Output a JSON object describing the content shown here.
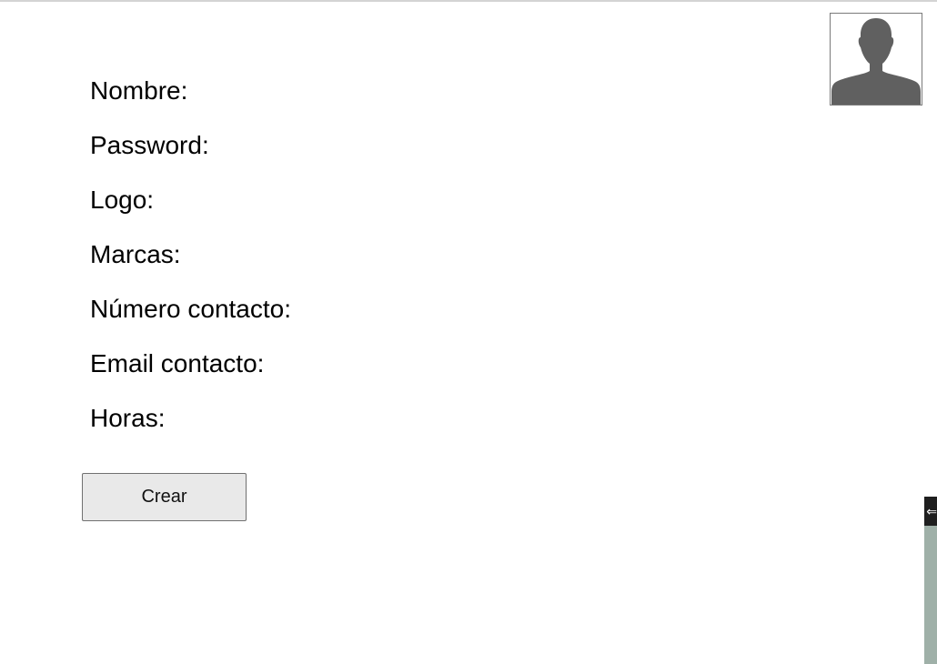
{
  "avatar": {
    "icon": "user-silhouette-icon",
    "color": "#606060"
  },
  "form": {
    "fields": [
      {
        "label": "Nombre:"
      },
      {
        "label": "Password:"
      },
      {
        "label": "Logo:"
      },
      {
        "label": "Marcas:"
      },
      {
        "label": "Número contacto:"
      },
      {
        "label": "Email contacto:"
      },
      {
        "label": "Horas:"
      }
    ],
    "submit_label": "Crear"
  },
  "side_widget": {
    "handle_icon": "expand-arrow-icon",
    "handle_glyph": "⇐"
  }
}
